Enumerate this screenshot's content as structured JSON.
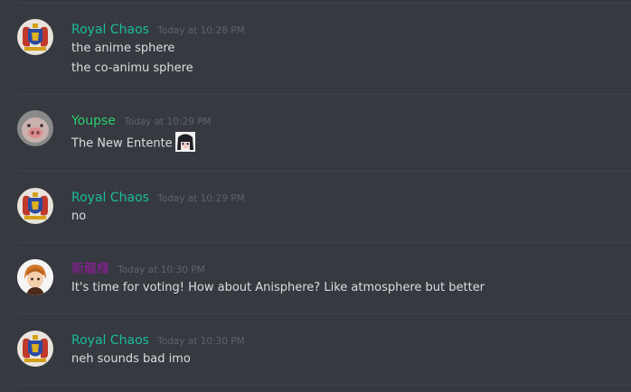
{
  "colors": {
    "background": "#36393f",
    "divider": "#40434a",
    "message_text": "#dcddde",
    "timestamp": "#5f6268"
  },
  "messages": [
    {
      "author": "Royal Chaos",
      "author_color": "#1abc9c",
      "timestamp": "Today at 10:28 PM",
      "avatar_icon": "coat-of-arms-icon",
      "lines": [
        "the anime sphere",
        "the co-animu sphere"
      ]
    },
    {
      "author": "Youpse",
      "author_color": "#2ecc71",
      "timestamp": "Today at 10:29 PM",
      "avatar_icon": "pig-face-icon",
      "lines": [
        "The New Entente"
      ],
      "emoji": "anime-girl-emoji"
    },
    {
      "author": "Royal Chaos",
      "author_color": "#1abc9c",
      "timestamp": "Today at 10:29 PM",
      "avatar_icon": "coat-of-arms-icon",
      "lines": [
        "no"
      ]
    },
    {
      "author": "新龍様",
      "author_color": "#9b1aa8",
      "timestamp": "Today at 10:30 PM",
      "avatar_icon": "anime-character-icon",
      "lines": [
        "It's time for voting! How about Anisphere? Like atmosphere but better"
      ]
    },
    {
      "author": "Royal Chaos",
      "author_color": "#1abc9c",
      "timestamp": "Today at 10:30 PM",
      "avatar_icon": "coat-of-arms-icon",
      "lines": [
        "neh sounds bad imo"
      ]
    }
  ]
}
